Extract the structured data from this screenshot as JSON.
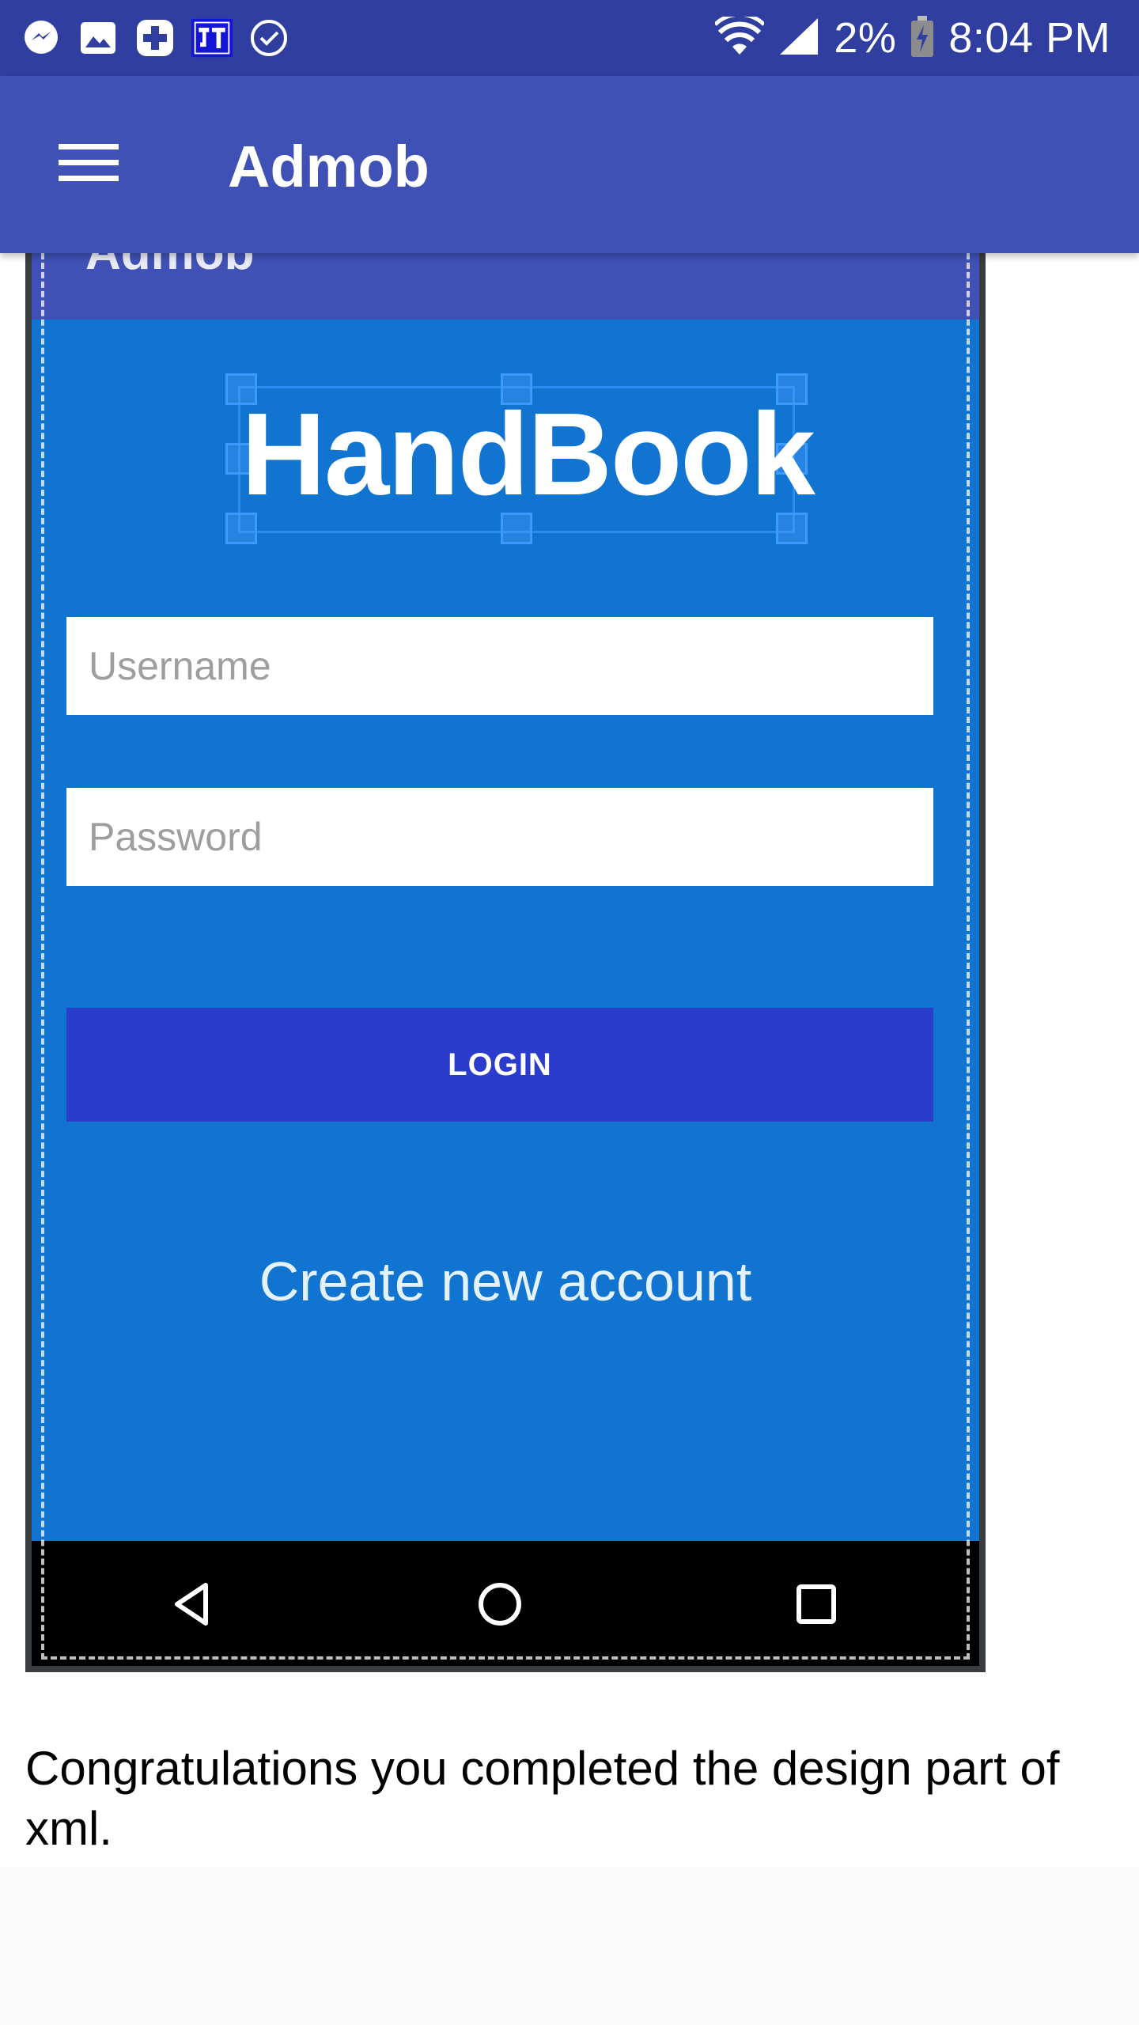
{
  "status_bar": {
    "battery": "2%",
    "time": "8:04 PM"
  },
  "app_bar": {
    "title": "Admob"
  },
  "mockup": {
    "toolbar_title": "Admob",
    "logo": "HandBook",
    "username_placeholder": "Username",
    "password_placeholder": "Password",
    "login_label": "LOGIN",
    "create_account": "Create new account"
  },
  "caption": "Congratulations you completed the design part of xml.",
  "colors": {
    "status_bar": "#303f9f",
    "app_bar": "#3f51b5",
    "mock_bg": "#1174d1",
    "login_button": "#2b3bcc"
  }
}
